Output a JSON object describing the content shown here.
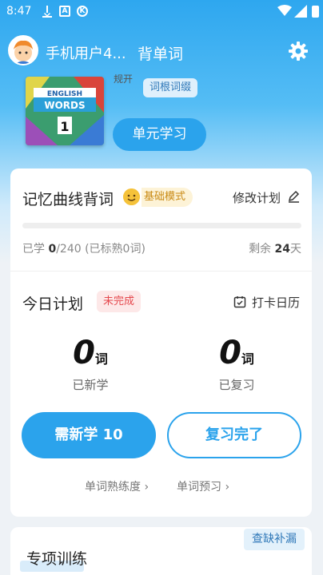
{
  "status_bar": {
    "time": "8:47",
    "icons": [
      "download-icon",
      "a-icon",
      "k-icon",
      "wifi-icon",
      "signal-icon",
      "battery-icon"
    ]
  },
  "header": {
    "user_name": "手机用户4...",
    "title": "背单词",
    "settings_icon": "gear-icon"
  },
  "unit": {
    "book_cover_lines": [
      "ENGLISH",
      "WORDS",
      "1"
    ],
    "sub_text": "规开",
    "root_chip": "词根词缀",
    "study_button": "单元学习"
  },
  "plan": {
    "title": "记忆曲线背词",
    "mode": "基础模式",
    "edit_label": "修改计划",
    "progress_fraction": 0,
    "learned_prefix": "已学 ",
    "learned_count": "0",
    "learned_total": "/240 (已标熟0词)",
    "remaining_prefix": "剩余 ",
    "remaining_days": "24",
    "remaining_suffix": "天"
  },
  "today": {
    "title": "今日计划",
    "status": "未完成",
    "calendar_label": "打卡日历",
    "new_count": "0",
    "new_unit": "词",
    "new_label": "已新学",
    "review_count": "0",
    "review_unit": "词",
    "review_label": "已复习",
    "learn_button": "需新学 10",
    "review_button": "复习完了",
    "link_proficiency": "单词熟练度 ›",
    "link_preview": "单词预习 ›"
  },
  "training": {
    "title": "专项训练",
    "fill_gap_chip": "查缺补漏"
  },
  "colors": {
    "primary": "#2ba3ec",
    "warning": "#e5484d",
    "mode": "#c98a14"
  }
}
